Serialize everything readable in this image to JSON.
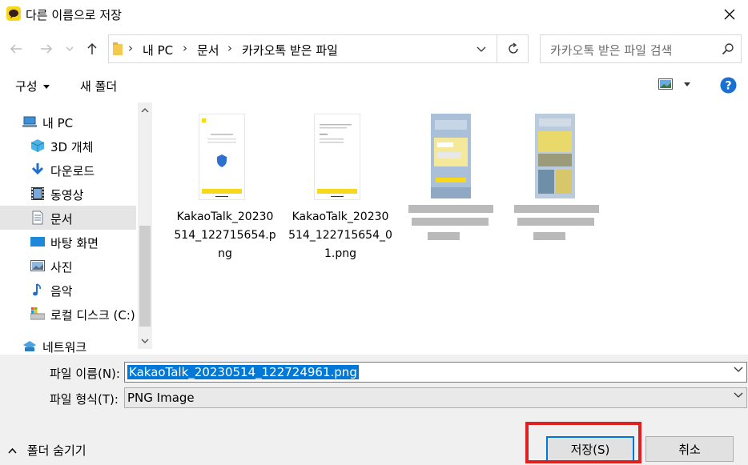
{
  "window": {
    "title": "다른 이름으로 저장"
  },
  "nav": {
    "breadcrumbs": [
      "내 PC",
      "문서",
      "카카오톡 받은 파일"
    ],
    "search_placeholder": "카카오톡 받은 파일 검색"
  },
  "toolbar": {
    "organize_label": "구성",
    "new_folder_label": "새 폴더"
  },
  "sidebar": {
    "items": [
      {
        "label": "내 PC",
        "icon": "pc-icon"
      },
      {
        "label": "3D 개체",
        "icon": "3d-objects-icon"
      },
      {
        "label": "다운로드",
        "icon": "download-icon"
      },
      {
        "label": "동영상",
        "icon": "video-icon"
      },
      {
        "label": "문서",
        "icon": "document-icon",
        "selected": true
      },
      {
        "label": "바탕 화면",
        "icon": "desktop-icon"
      },
      {
        "label": "사진",
        "icon": "pictures-icon"
      },
      {
        "label": "음악",
        "icon": "music-icon"
      },
      {
        "label": "로컬 디스크 (C:)",
        "icon": "local-disk-icon"
      },
      {
        "label": "네트워크",
        "icon": "network-icon"
      }
    ]
  },
  "files": [
    {
      "name": "KakaoTalk_20230514_122715654.png",
      "name_line1": "KakaoTalk_20230",
      "name_line2": "514_122715654.p",
      "name_line3": "ng"
    },
    {
      "name": "KakaoTalk_20230514_122715654_01.png",
      "name_line1": "KakaoTalk_20230",
      "name_line2": "514_122715654_0",
      "name_line3": "1.png"
    },
    {
      "name": "blurred-file-1",
      "blurred": true
    },
    {
      "name": "blurred-file-2",
      "blurred": true
    }
  ],
  "form": {
    "filename_label": "파일 이름(N):",
    "filename_value": "KakaoTalk_20230514_122724961.png",
    "filetype_label": "파일 형식(T):",
    "filetype_value": "PNG Image",
    "hide_folders_label": "폴더 숨기기",
    "save_label": "저장(S)",
    "cancel_label": "취소"
  },
  "colors": {
    "accent": "#0078d7",
    "highlight": "#e02020",
    "kakao_yellow": "#f7d81b"
  }
}
